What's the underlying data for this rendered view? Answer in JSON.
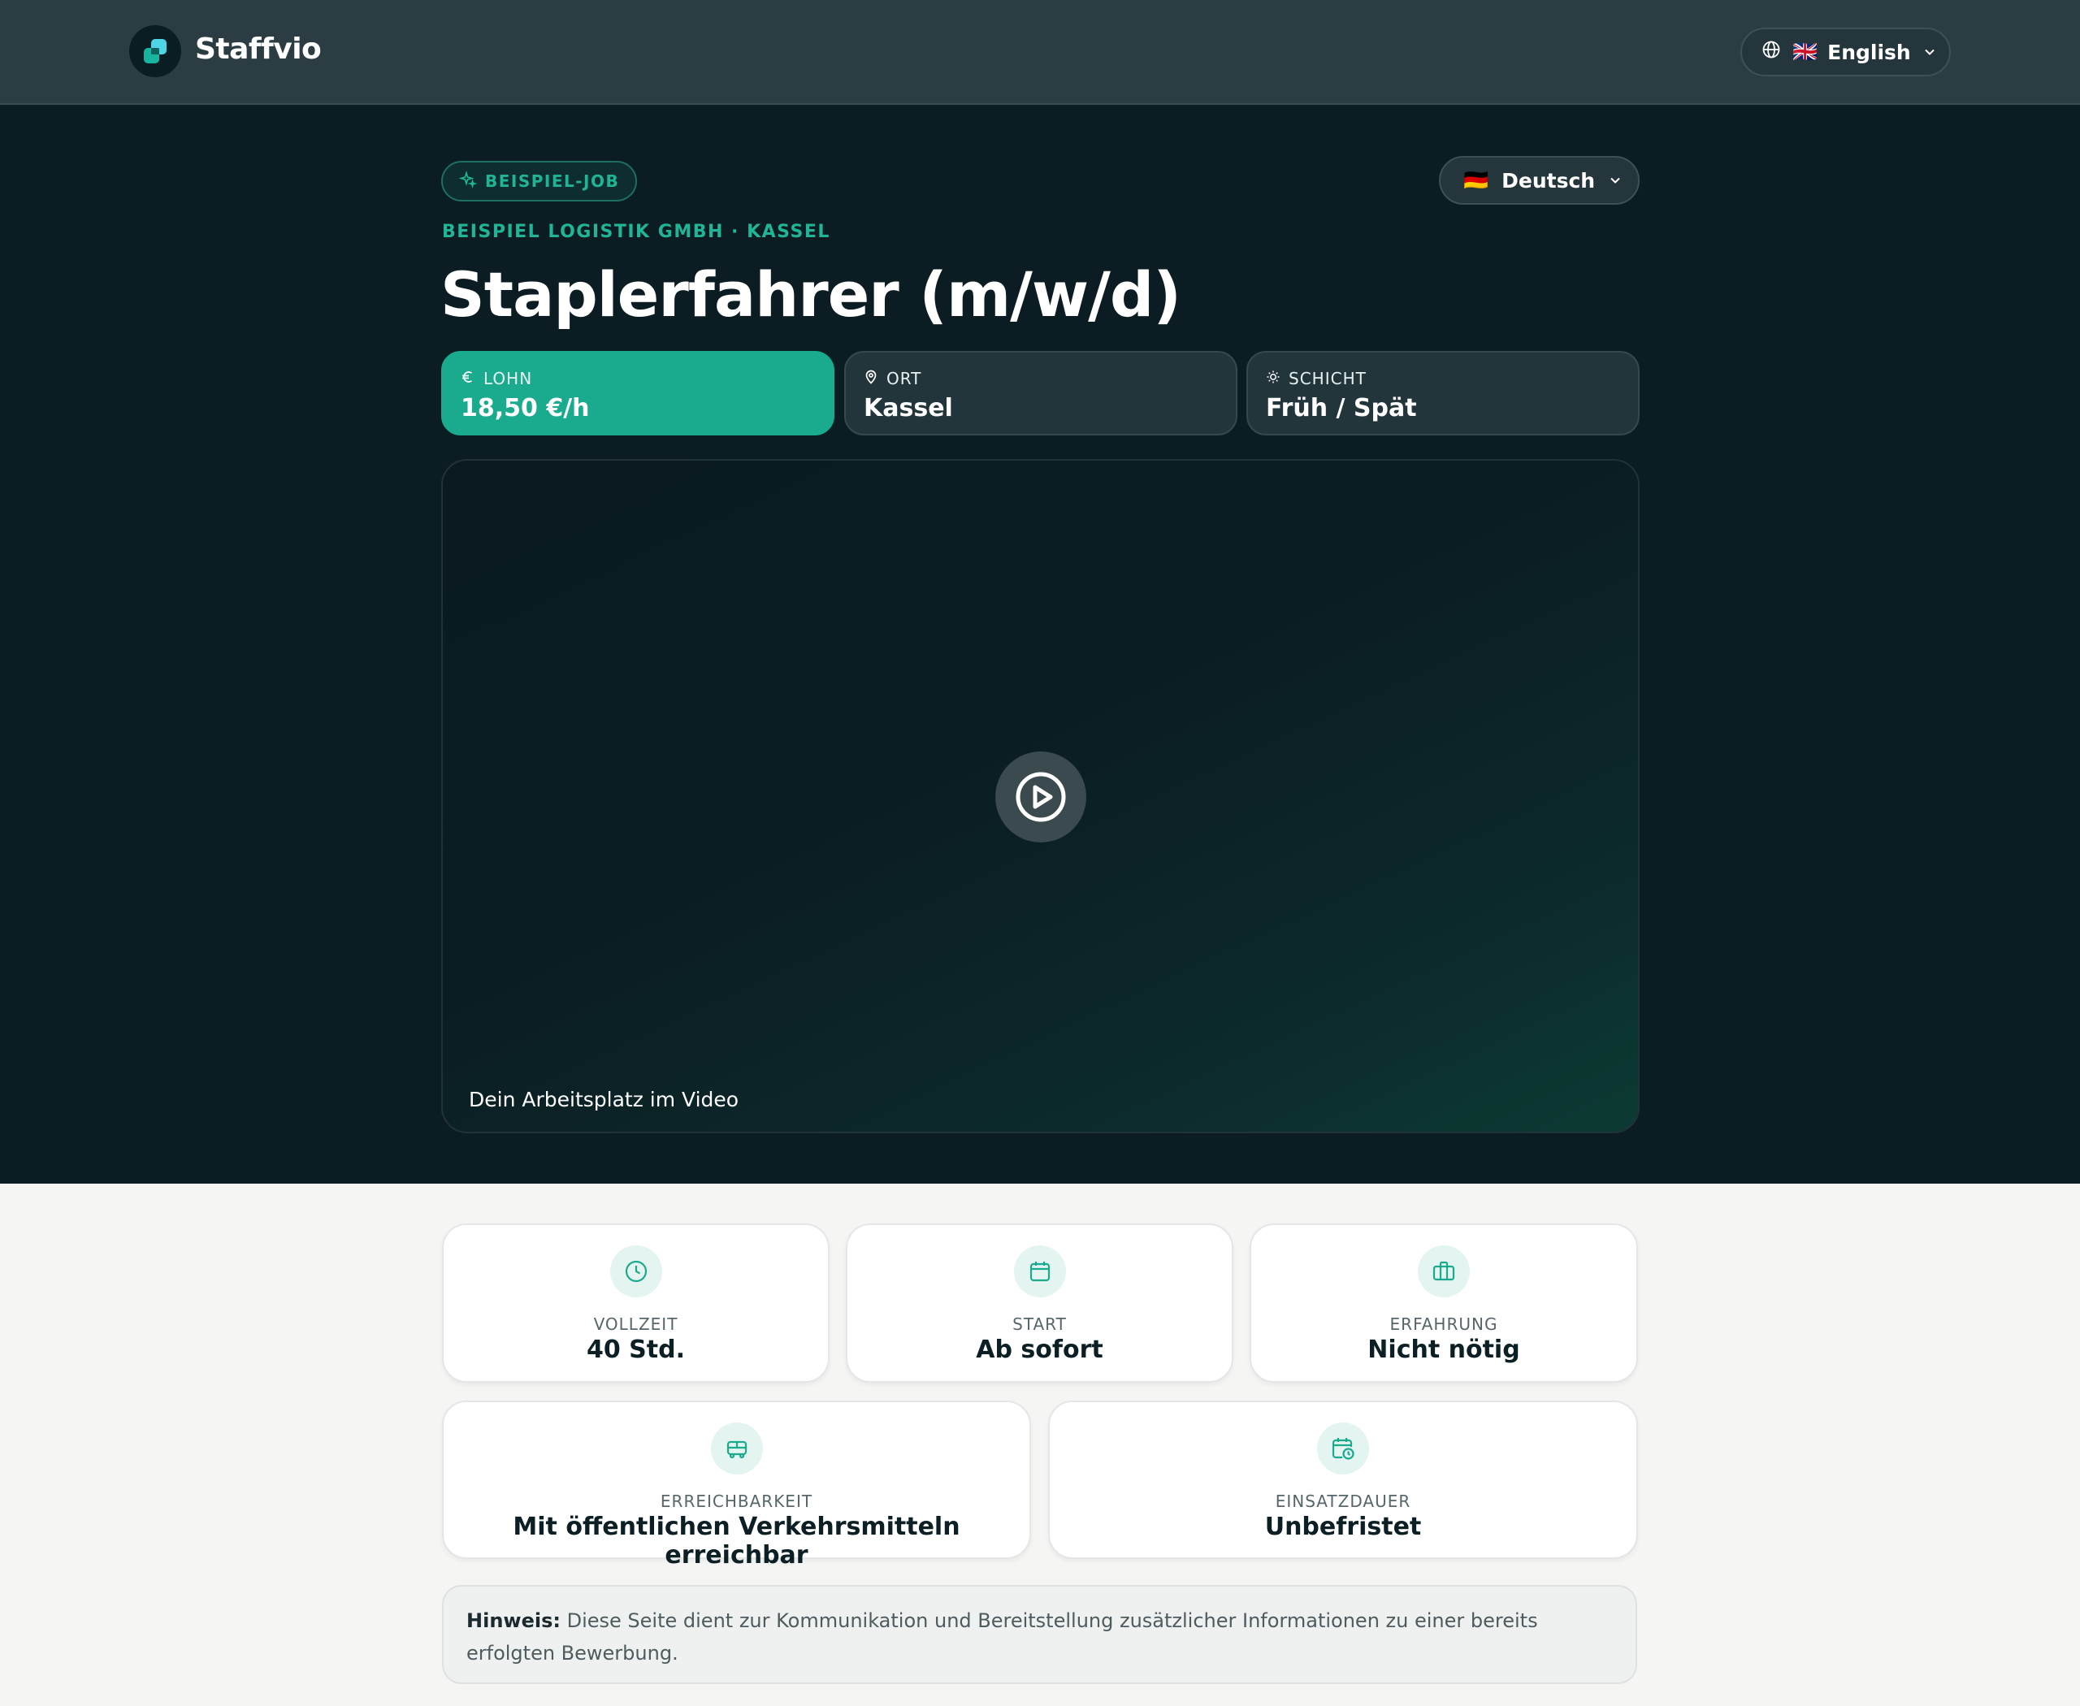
{
  "nav": {
    "brand": "Staffvio",
    "language": {
      "flag": "🇬🇧",
      "label": "English"
    }
  },
  "hero": {
    "badge": "BEISPIEL-JOB",
    "language": {
      "flag": "🇩🇪",
      "label": "Deutsch"
    },
    "company_location": "BEISPIEL LOGISTIK GMBH · KASSEL",
    "title": "Staplerfahrer (m/w/d)",
    "stats": [
      {
        "icon": "euro-icon",
        "label": "LOHN",
        "value": "18,50 €/h"
      },
      {
        "icon": "location-pin-icon",
        "label": "ORT",
        "value": "Kassel"
      },
      {
        "icon": "sun-icon",
        "label": "SCHICHT",
        "value": "Früh / Spät"
      }
    ],
    "video": {
      "caption": "Dein Arbeitsplatz im Video"
    }
  },
  "details": [
    {
      "icon": "clock-icon",
      "label": "VOLLZEIT",
      "value": "40 Std."
    },
    {
      "icon": "calendar-icon",
      "label": "START",
      "value": "Ab sofort"
    },
    {
      "icon": "briefcase-icon",
      "label": "ERFAHRUNG",
      "value": "Nicht nötig"
    },
    {
      "icon": "bus-icon",
      "label": "ERREICHBARKEIT",
      "value": "Mit öffentlichen Verkehrsmitteln erreichbar"
    },
    {
      "icon": "calendar-clock-icon",
      "label": "EINSATZDAUER",
      "value": "Unbefristet"
    }
  ],
  "note": {
    "label": "Hinweis:",
    "text": "Diese Seite dient zur Kommunikation und Bereitstellung zusätzlicher Informationen zu einer bereits erfolgten Bewerbung."
  },
  "colors": {
    "accent": "#1aab8e",
    "nav_bg": "#2b3d43",
    "hero_bg": "#0b1c22",
    "page_bg": "#f5f5f4"
  }
}
